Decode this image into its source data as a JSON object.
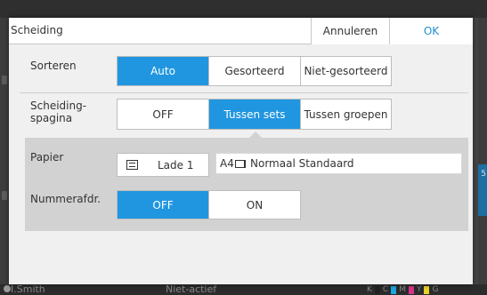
{
  "background": {
    "user_name": "I.Smith",
    "status": "Niet-actief",
    "side_number": "5",
    "toner_labels": [
      "K",
      "C",
      "M",
      "Y",
      "G"
    ],
    "toner_colors": [
      "#222222",
      "#1aa7e0",
      "#d6338c",
      "#e8d12a",
      "#8c8c8c"
    ]
  },
  "dialog": {
    "title": "Scheiding",
    "cancel_label": "Annuleren",
    "ok_label": "OK"
  },
  "sorteren": {
    "label": "Sorteren",
    "options": [
      "Auto",
      "Gesorteerd",
      "Niet-gesorteerd"
    ],
    "selected": "Auto"
  },
  "scheidingspagina": {
    "label_line1": "Scheiding-",
    "label_line2": "spagina",
    "options": [
      "OFF",
      "Tussen sets",
      "Tussen groepen"
    ],
    "selected": "Tussen sets"
  },
  "papier": {
    "label": "Papier",
    "tray_label": "Lade 1",
    "paper_size": "A4",
    "paper_type": "Normaal Standaard"
  },
  "nummerafdr": {
    "label": "Nummerafdr.",
    "options": [
      "OFF",
      "ON"
    ],
    "selected": "OFF"
  },
  "colors": {
    "accent": "#2196e0",
    "ok_text": "#1e8fd0"
  }
}
